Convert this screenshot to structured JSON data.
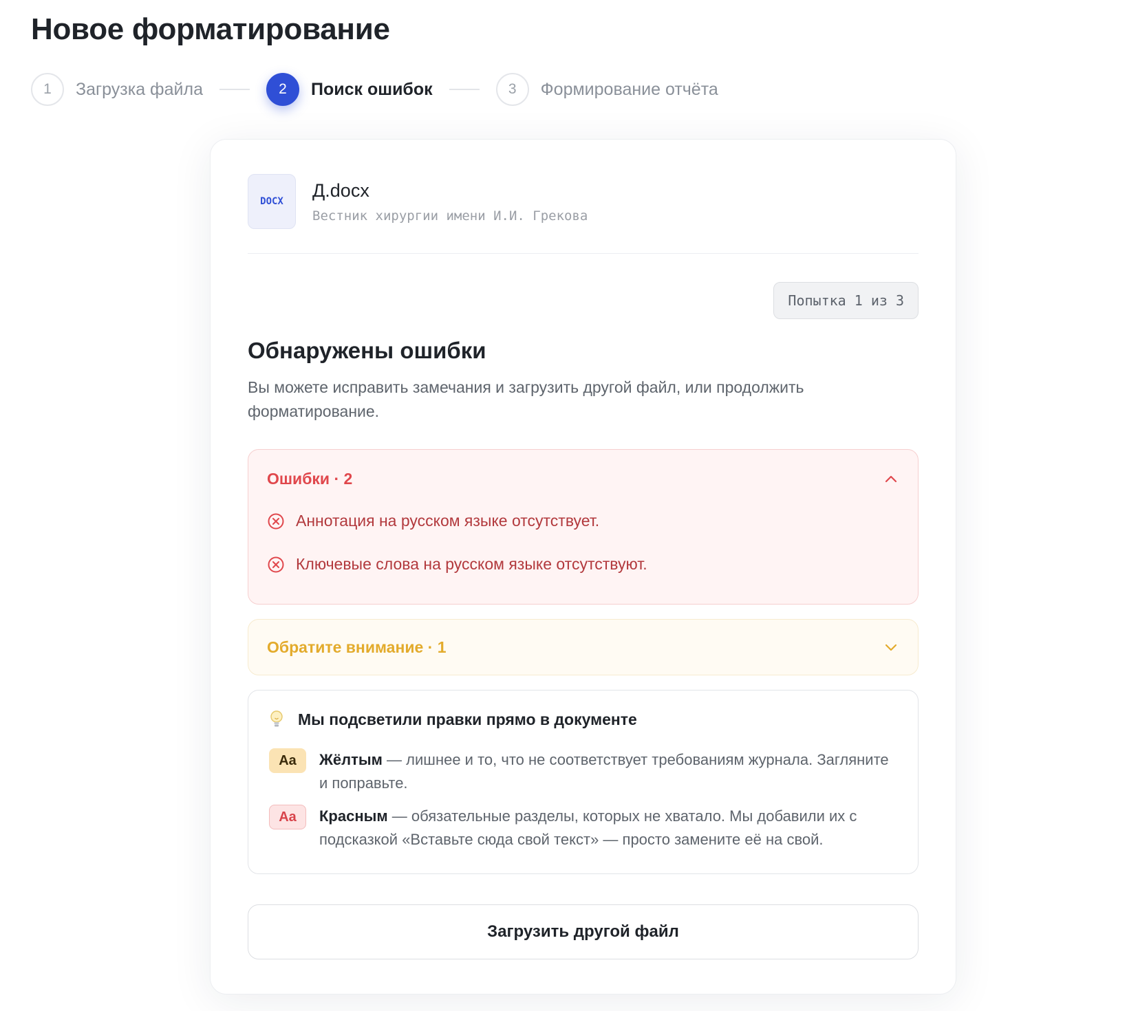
{
  "page": {
    "title": "Новое форматирование"
  },
  "stepper": {
    "steps": [
      {
        "number": "1",
        "label": "Загрузка файла",
        "state": "inactive"
      },
      {
        "number": "2",
        "label": "Поиск ошибок",
        "state": "active"
      },
      {
        "number": "3",
        "label": "Формирование отчёта",
        "state": "inactive"
      }
    ]
  },
  "file": {
    "type_label": "DOCX",
    "name": "Д.docx",
    "journal": "Вестник хирургии имени И.И. Грекова"
  },
  "attempt": {
    "label": "Попытка 1 из 3"
  },
  "results": {
    "title": "Обнаружены ошибки",
    "description": "Вы можете исправить замечания и загрузить другой файл, или продолжить форматирование."
  },
  "errors": {
    "title": "Ошибки · 2",
    "expanded": true,
    "items": [
      {
        "text": "Аннотация на русском языке отсутствует.",
        "icon": "circle-x-icon"
      },
      {
        "text": "Ключевые слова на русском языке отсутствуют.",
        "icon": "circle-x-icon"
      }
    ]
  },
  "warnings": {
    "title": "Обратите внимание · 1",
    "expanded": false
  },
  "highlights": {
    "icon": "lightbulb-icon",
    "title": "Мы подсветили правки прямо в документе",
    "legend": [
      {
        "chip": "Aa",
        "term": "Жёлтым",
        "text": " — лишнее и то, что не соответствует требованиям журнала. Загляните и поправьте.",
        "color": "#fbe3b4"
      },
      {
        "chip": "Aa",
        "term": "Красным",
        "text": " — обязательные разделы, которых не хватало. Мы добавили их с подсказкой «Вставьте сюда свой текст» — просто замените её на свой.",
        "color": "#fde4e4"
      }
    ]
  },
  "actions": {
    "upload_label": "Загрузить другой файл"
  },
  "colors": {
    "accent": "#2f4fd6",
    "error": "#e0474c",
    "warning": "#e3ab2c"
  }
}
